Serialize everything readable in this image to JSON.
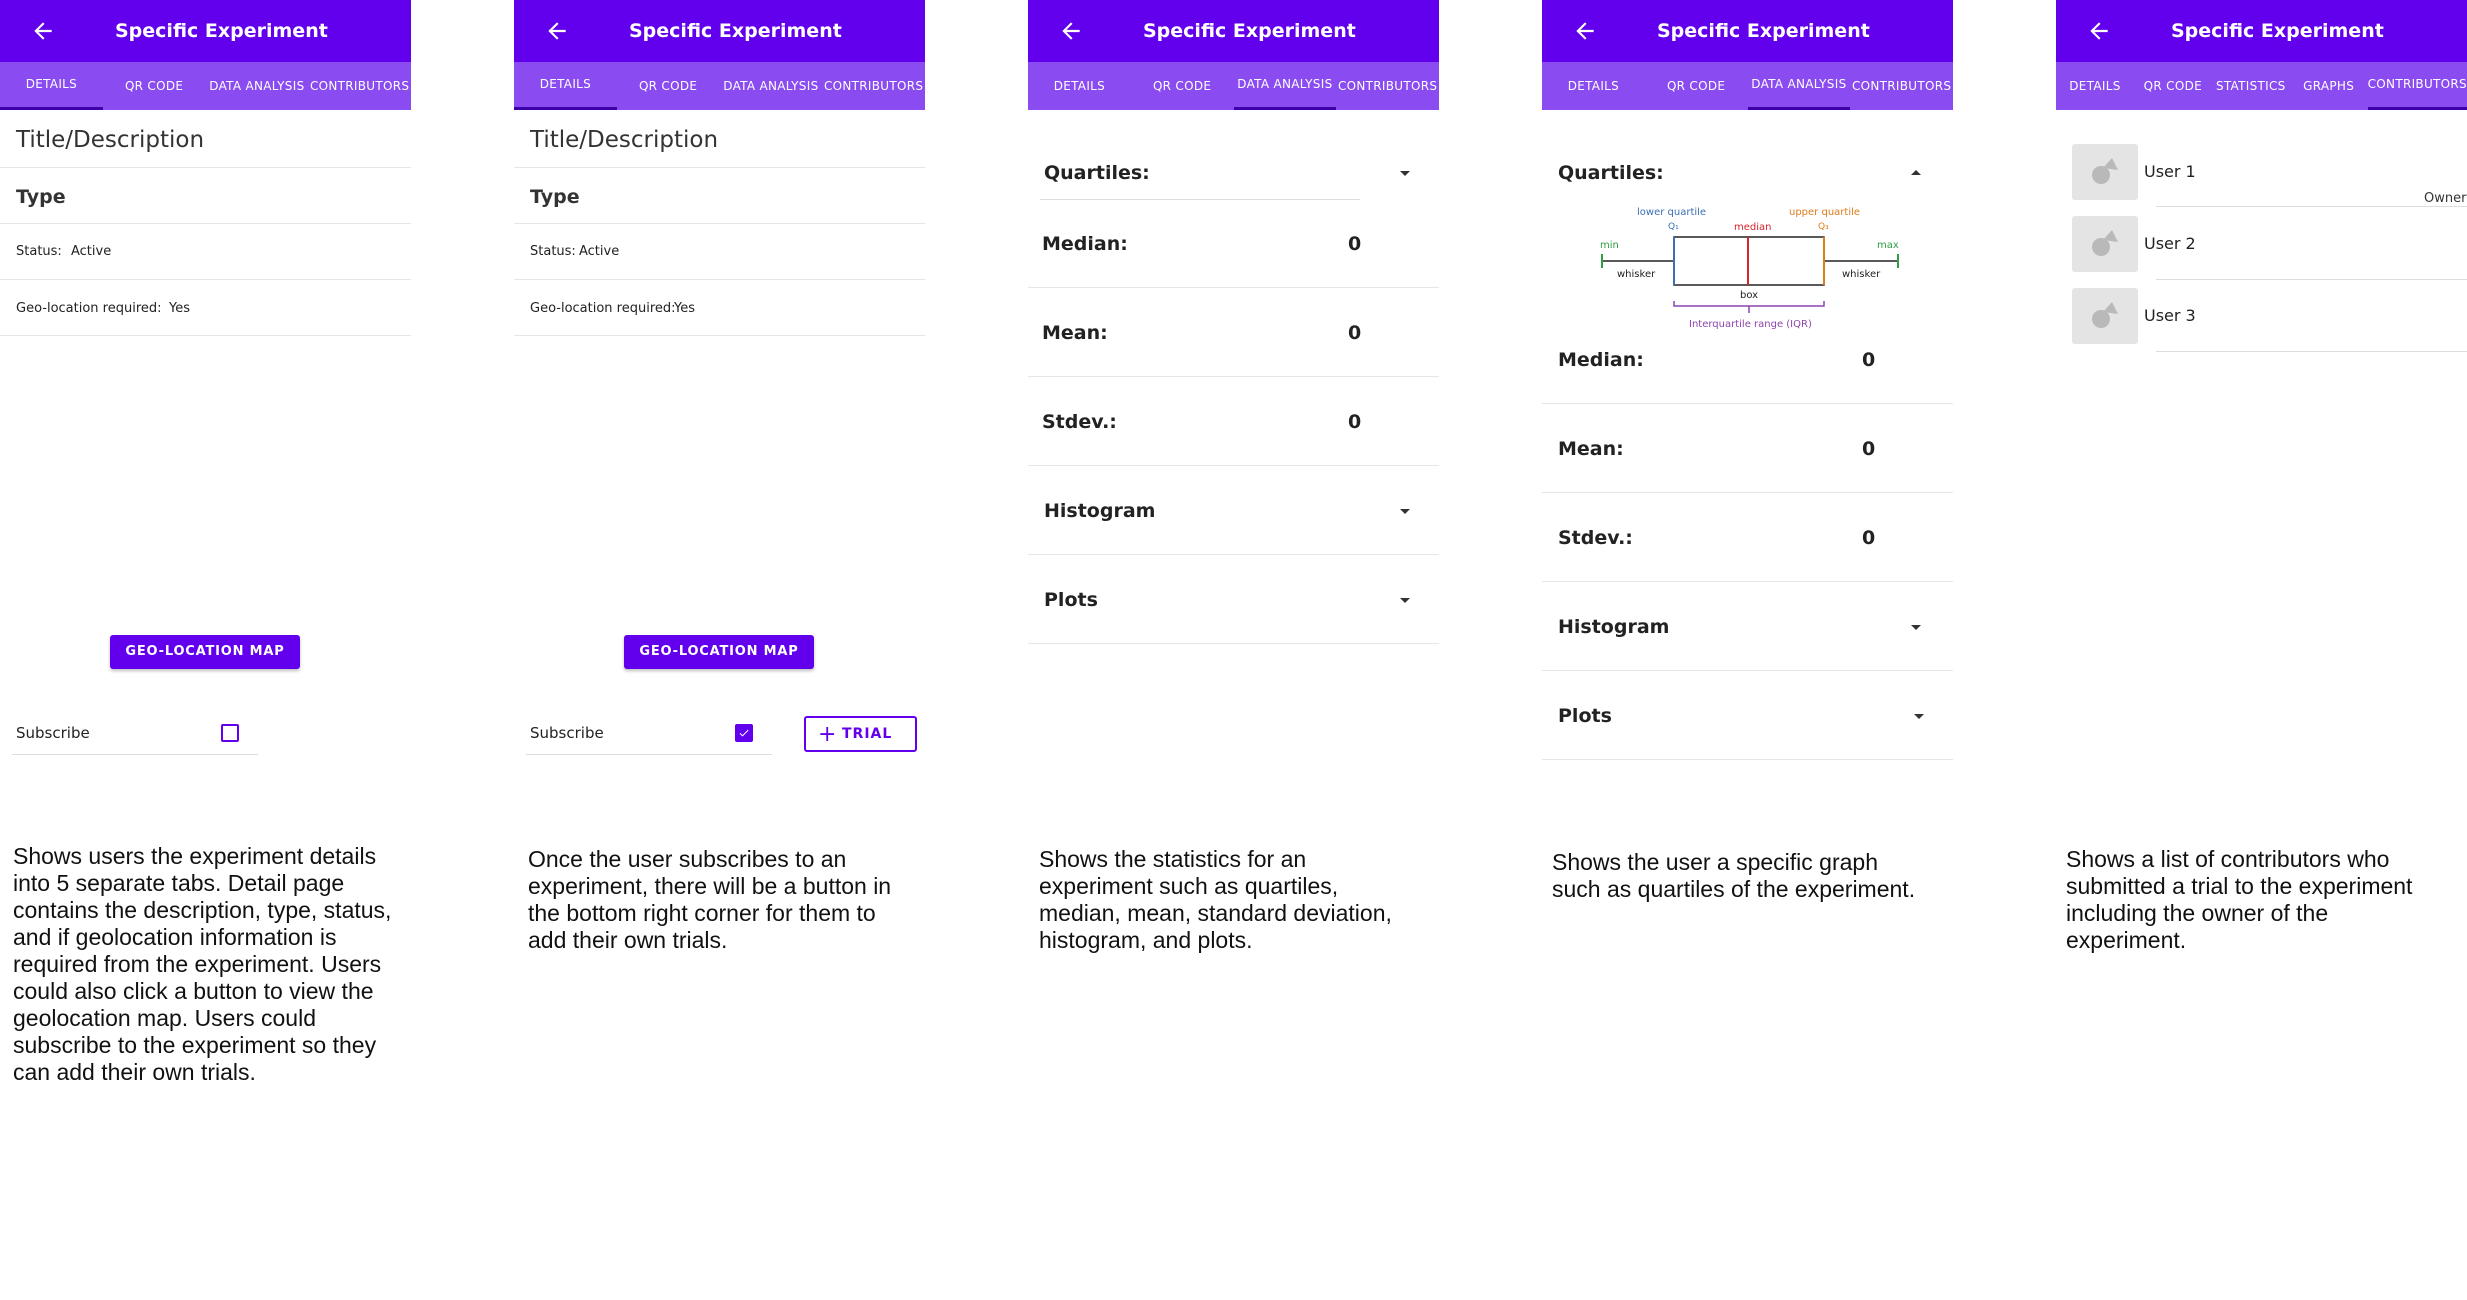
{
  "app": {
    "title": "Specific Experiment"
  },
  "tabs_standard": [
    "DETAILS",
    "QR CODE",
    "DATA ANALYSIS",
    "CONTRIBUTORS"
  ],
  "tabs_extended": [
    "DETAILS",
    "QR CODE",
    "STATISTICS",
    "GRAPHS",
    "CONTRIBUTORS"
  ],
  "details": {
    "title": "Title/Description",
    "type": "Type",
    "status_label": "Status:",
    "status_value": "Active",
    "geo_label": "Geo-location required:",
    "geo_value": "Yes",
    "geo_button": "GEO-LOCATION MAP",
    "subscribe": "Subscribe",
    "trial_button": "TRIAL"
  },
  "stats": {
    "quartiles": "Quartiles:",
    "median": "Median:",
    "mean": "Mean:",
    "stdev": "Stdev.:",
    "median_value": "0",
    "mean_value": "0",
    "stdev_value": "0",
    "histogram": "Histogram",
    "plots": "Plots"
  },
  "boxplot": {
    "lower_quartile": "lower quartile",
    "upper_quartile": "upper quartile",
    "median": "median",
    "q1": "Q₁",
    "q3": "Q₃",
    "min": "min",
    "max": "max",
    "whisker": "whisker",
    "box": "box",
    "iqr": "Interquartile range (IQR)"
  },
  "contributors": {
    "users": [
      "User 1",
      "User 2",
      "User 3"
    ],
    "owner": "Owner"
  },
  "captions": {
    "screen1": "Shows users the experiment details into 5 separate tabs. Detail page contains the description, type, status, and if geolocation information is required from the experiment. Users could also click a button to view the geolocation map. Users could subscribe to the experiment so they can add their own trials.",
    "screen2": "Once the user subscribes to an experiment, there will be a button in the bottom right corner for them to add their own trials.",
    "screen3": "Shows the statistics for an experiment such as quartiles, median, mean, standard deviation, histogram, and plots.",
    "screen4": "Shows the user a specific graph such as quartiles of the experiment.",
    "screen5": "Shows a list of contributors who submitted a trial to the experiment including the owner of the experiment."
  },
  "colors": {
    "primary": "#6200ee",
    "tab_bar": "#8a4cf0",
    "indicator": "#3d00a8"
  }
}
